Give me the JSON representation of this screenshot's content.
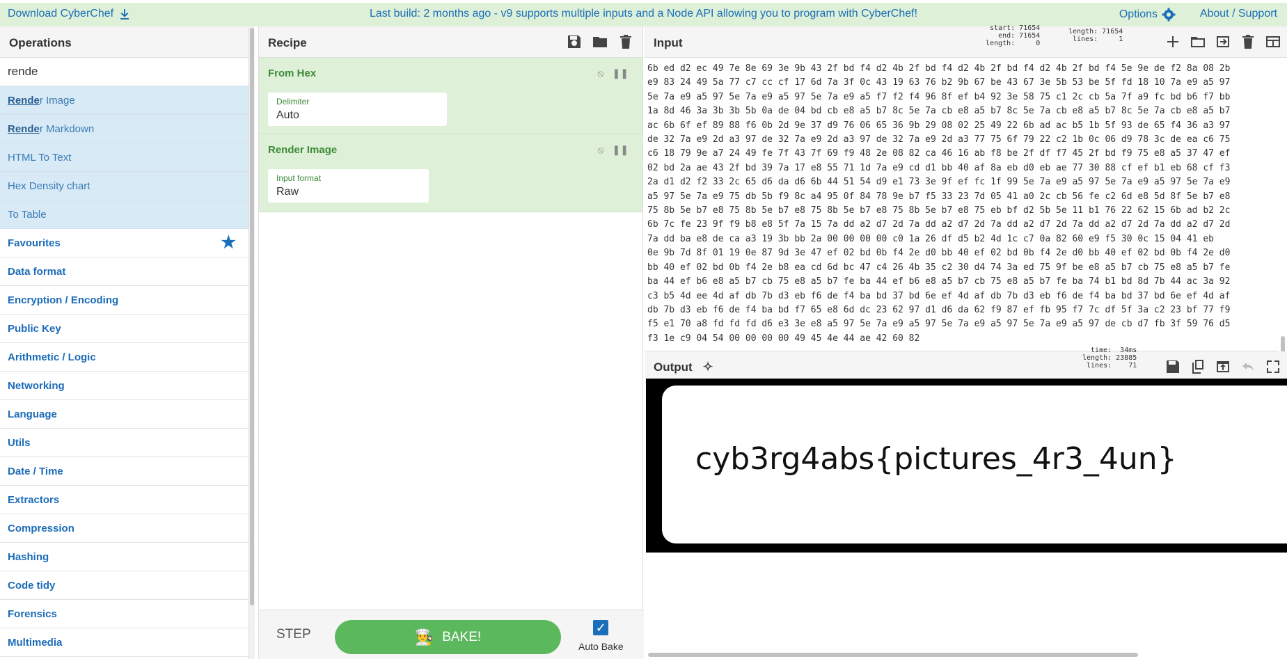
{
  "topbar": {
    "download": "Download CyberChef",
    "notice": "Last build: 2 months ago - v9 supports multiple inputs and a Node API allowing you to program with CyberChef!",
    "options": "Options",
    "about": "About / Support"
  },
  "operations": {
    "title": "Operations",
    "search_value": "rende",
    "results": [
      {
        "match": "Rende",
        "rest": "r Image"
      },
      {
        "match": "Rende",
        "rest": "r Markdown"
      },
      {
        "match": "",
        "rest": "HTML To Text"
      },
      {
        "match": "",
        "rest": "Hex Density chart"
      },
      {
        "match": "",
        "rest": "To Table"
      }
    ],
    "categories": [
      "Favourites",
      "Data format",
      "Encryption / Encoding",
      "Public Key",
      "Arithmetic / Logic",
      "Networking",
      "Language",
      "Utils",
      "Date / Time",
      "Extractors",
      "Compression",
      "Hashing",
      "Code tidy",
      "Forensics",
      "Multimedia"
    ]
  },
  "recipe": {
    "title": "Recipe",
    "ops": [
      {
        "name": "From Hex",
        "field_label": "Delimiter",
        "field_value": "Auto"
      },
      {
        "name": "Render Image",
        "field_label": "Input format",
        "field_value": "Raw"
      }
    ],
    "step": "STEP",
    "bake": "BAKE!",
    "auto_bake": "Auto Bake"
  },
  "input": {
    "title": "Input",
    "meta_left": "start: 71654\n  end: 71654\nlength:     0",
    "meta_right": "length: 71654\n lines:     1",
    "hex_lines": [
      "6b ed d2 ec 49 7e 8e 69 3e 9b 43 2f bd f4 d2 4b 2f bd f4 d2 4b 2f bd f4 d2 4b 2f bd f4 5e 9e de f2 8a 08 2b",
      "e9 83 24 49 5a 77 c7 cc cf 17 6d 7a 3f 0c 43 19 63 76 b2 9b 67 be 43 67 3e 5b 53 be 5f fd 18 10 7a e9 a5 97",
      "5e 7a e9 a5 97 5e 7a e9 a5 97 5e 7a e9 a5 f7 f2 f4 96 8f ef b4 92 3e 58 75 c1 2c cb 5a 7f a9 fc bd b6 f7 bb",
      "1a 8d 46 3a 3b 3b 5b 0a de 04 bd cb e8 a5 b7 8c 5e 7a cb e8 a5 b7 8c 5e 7a cb e8 a5 b7 8c 5e 7a cb e8 a5 b7",
      "ac 6b 6f ef 89 88 f6 0b 2d 9e 37 d9 76 06 65 36 9b 29 08 02 25 49 22 6b ad ac b5 1b 5f 93 de 65 f4 36 a3 97",
      "de 32 7a e9 2d a3 97 de 32 7a e9 2d a3 97 de 32 7a e9 2d a3 77 75 6f 79 22 c2 1b 0c 06 d9 78 3c de ea c6 75",
      "c6 18 79 9e a7 24 49 fe 7f 43 7f 69 f9 48 2e 08 82 ca 46 16 ab f8 be 2f df f7 45 2f bd f9 75 e8 a5 37 47 ef",
      "02 bd 2a ae 43 2f bd 39 7a 17 e8 55 71 1d 7a e9 cd d1 bb 40 af 8a eb d0 eb ae 77 30 88 cf ef b1 eb 68 cf f3",
      "2a d1 d2 f2 33 2c 65 d6 da d6 6b 44 51 54 d9 e1 73 3e 9f ef fc 1f 99 5e 7a e9 a5 97 5e 7a e9 a5 97 5e 7a e9",
      "a5 97 5e 7a e9 75 db 5b f9 8c a4 95 0f 84 78 9e b7 f5 33 23 7d 05 41 a0 2c cb 56 fe c2 6d e8 5d 8f 5e b7 e8",
      "75 8b 5e b7 e8 75 8b 5e b7 e8 75 8b 5e b7 e8 75 8b 5e b7 e8 75 eb bf d2 5b 5e 11 b1 76 22 62 15 6b ad b2 2c",
      "6b 7c fe 23 9f f9 b8 e8 5f 7a 15 7a dd a2 d7 2d 7a dd a2 d7 2d 7a dd a2 d7 2d 7a dd a2 d7 2d 7a dd a2 d7 2d",
      "7a dd ba e8 de ca a3 19 3b bb 2a 00 00 00 00 c0 1a 26 df d5 b2 4d 1c c7 0a 82 60 e9 f5 30 0c 15 04 41 eb",
      "0e 9b 7d 8f 01 19 0e 87 9d 3e 47 ef 02 bd 0b f4 2e d0 bb 40 ef 02 bd 0b f4 2e d0 bb 40 ef 02 bd 0b f4 2e d0",
      "bb 40 ef 02 bd 0b f4 2e b8 ea cd 6d bc 47 c4 26 4b 35 c2 30 d4 74 3a ed 75 9f be e8 a5 b7 cb 75 e8 a5 b7 fe",
      "ba 44 ef b6 e8 a5 b7 cb 75 e8 a5 b7 fe ba 44 ef b6 e8 a5 b7 cb 75 e8 a5 b7 fe ba 74 b1 bd 8d 7b 44 ac 3a 92",
      "c3 b5 4d ee 4d af db 7b d3 eb f6 de f4 ba bd 37 bd 6e ef 4d af db 7b d3 eb f6 de f4 ba bd 37 bd 6e ef 4d af",
      "db 7b d3 eb f6 de f4 ba bd f7 65 e8 6d dc 23 62 97 d1 d6 da 62 f9 87 ef fb 95 f7 7c df 5f 3a c2 23 bf 77 f9",
      "f5 e1 70 a8 fd fd fd d6 e3 3e e8 a5 97 5e 7a e9 a5 97 5e 7a e9 a5 97 5e 7a e9 a5 97 de cb d7 fb 3f 59 76 d5",
      "f3 1e c9 04 54 00 00 00 00 49 45 4e 44 ae 42 60 82"
    ]
  },
  "output": {
    "title": "Output",
    "meta": "  time:  34ms\nlength: 23885\n lines:    71",
    "rendered_text": "cyb3rg4abs{pictures_4r3_4un}"
  },
  "colors": {
    "topbar_bg": "#dff0d8",
    "op_card_bg": "#dff0d8",
    "bake_green": "#5cb85c",
    "link_blue": "#1a6fb8"
  }
}
